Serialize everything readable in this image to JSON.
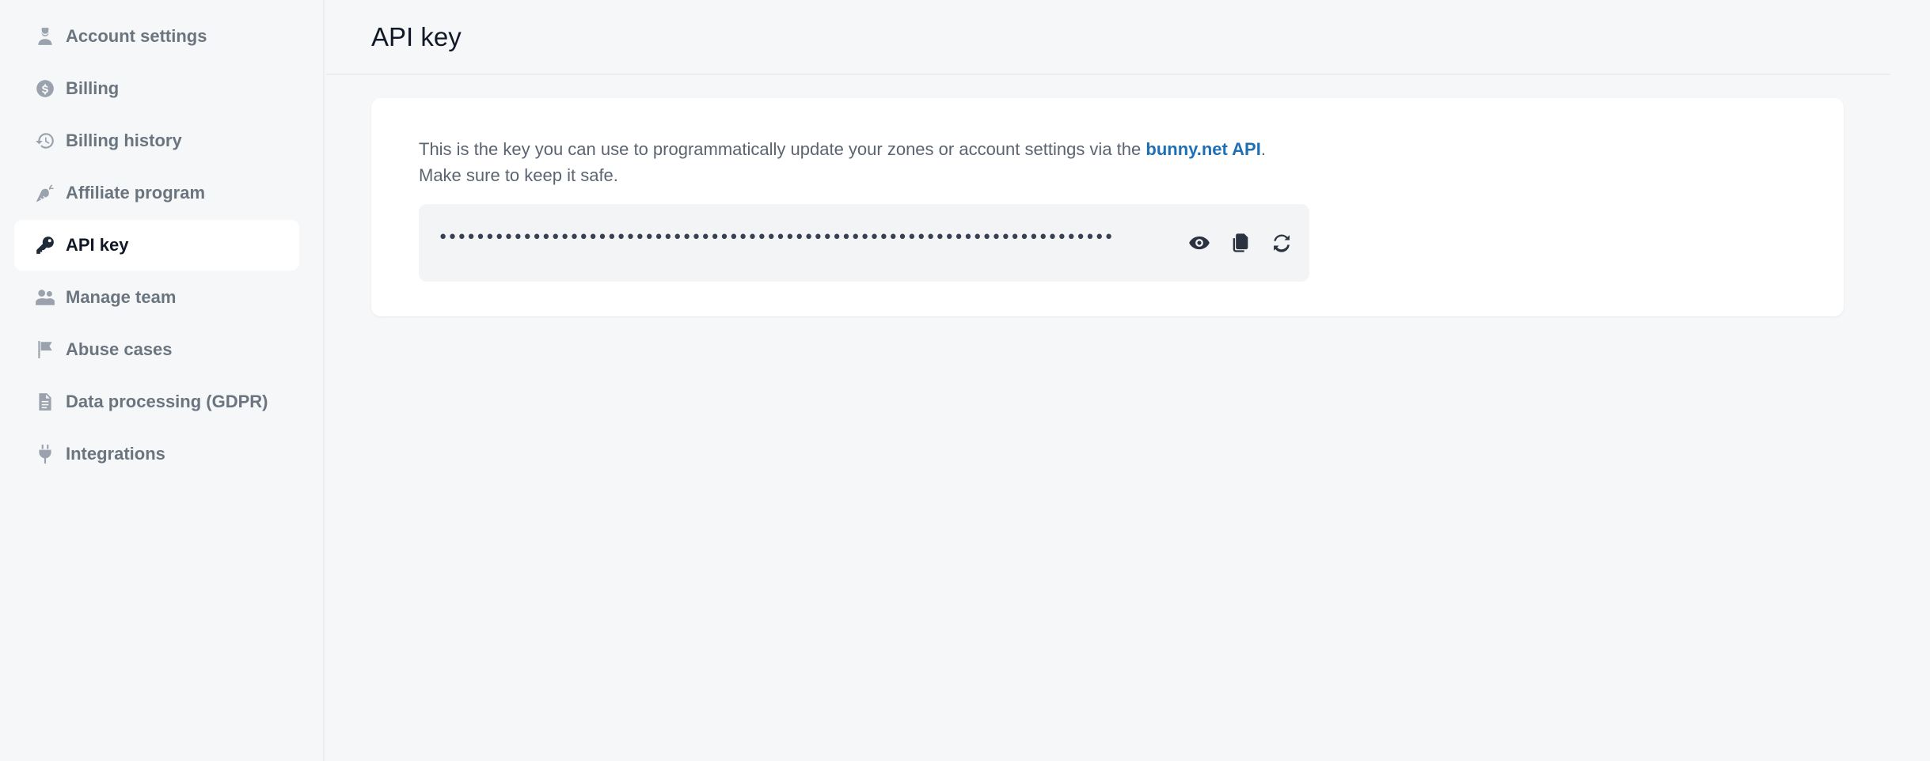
{
  "sidebar": {
    "items": [
      {
        "label": "Account settings",
        "icon": "user-tie-icon",
        "active": false
      },
      {
        "label": "Billing",
        "icon": "dollar-circle-icon",
        "active": false
      },
      {
        "label": "Billing history",
        "icon": "history-icon",
        "active": false
      },
      {
        "label": "Affiliate program",
        "icon": "carrot-icon",
        "active": false
      },
      {
        "label": "API key",
        "icon": "key-icon",
        "active": true
      },
      {
        "label": "Manage team",
        "icon": "users-icon",
        "active": false
      },
      {
        "label": "Abuse cases",
        "icon": "flag-icon",
        "active": false
      },
      {
        "label": "Data processing (GDPR)",
        "icon": "document-icon",
        "active": false
      },
      {
        "label": "Integrations",
        "icon": "plug-icon",
        "active": false
      }
    ]
  },
  "header": {
    "title": "API key"
  },
  "card": {
    "description_prefix": "This is the key you can use to programmatically update your zones or account settings via the ",
    "link_text": "bunny.net API",
    "description_suffix": ".",
    "description_line2": "Make sure to keep it safe.",
    "masked_key": "••••••••••••••••••••••••••••••••••••••••••••••••••••••••••••••••••••••••",
    "actions": {
      "show": "eye-icon",
      "copy": "copy-icon",
      "regenerate": "refresh-icon"
    }
  },
  "colors": {
    "background": "#f6f7f8",
    "card": "#ffffff",
    "link": "#1f6fb5",
    "nav_text": "#6b7580",
    "nav_active_text": "#111827"
  }
}
